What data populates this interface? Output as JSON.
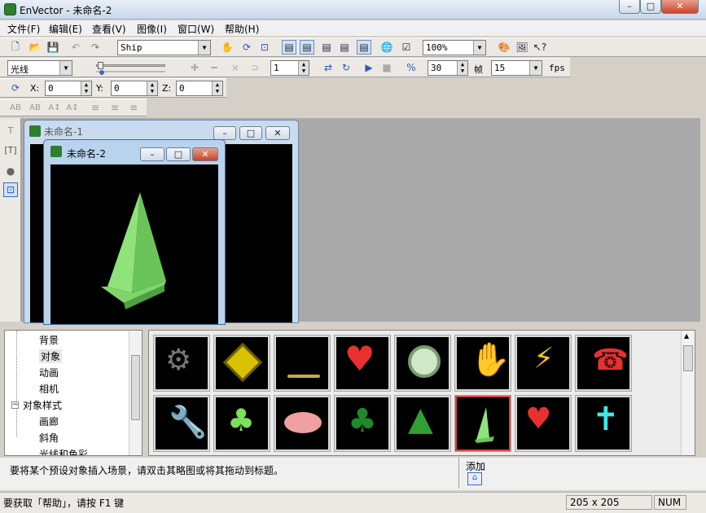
{
  "app": {
    "title": "EnVector - 未命名-2"
  },
  "titlebar": {
    "minimize": "–",
    "maximize": "□",
    "close": "✕"
  },
  "menubar": {
    "items": [
      "文件(F)",
      "编辑(E)",
      "查看(V)",
      "图像(I)",
      "窗口(W)",
      "帮助(H)"
    ]
  },
  "toolbar1": {
    "object_select": "Ship",
    "zoom_select": "100%"
  },
  "toolbar2": {
    "light_select": "光线",
    "frame_field": "1",
    "fps_value_field": "30",
    "frame_label": "帧",
    "fps_select": "15",
    "fps_label": "fps"
  },
  "toolbar3": {
    "x_label": "X:",
    "x_value": "0",
    "y_label": "Y:",
    "y_value": "0",
    "z_label": "Z:",
    "z_value": "0"
  },
  "documents": [
    {
      "title": "未命名-1"
    },
    {
      "title": "未命名-2"
    }
  ],
  "tree": {
    "items": [
      "背景",
      "对象",
      "动画",
      "相机",
      "对象样式",
      "画廊",
      "斜角",
      "光线和色彩"
    ]
  },
  "gallery": {
    "row1": [
      "gear-icon",
      "worker-sign-icon",
      "bird-icon",
      "heart-icon",
      "film-reel-icon",
      "flame-hand-icon",
      "lightning-icon",
      "phone-icon"
    ],
    "row2": [
      "wrench-icon",
      "clover-icon",
      "crab-icon",
      "four-leaf-clover-icon",
      "tree-icon",
      "ship-icon",
      "heart-arrow-icon",
      "cross-icon"
    ]
  },
  "hint": {
    "text": "要将某个预设对象插入场景，请双击其略图或将其拖动到标题。",
    "add_label": "添加"
  },
  "status": {
    "help_text": "要获取「帮助」，请按 F1 键",
    "size": "205 x 205",
    "num": "NUM"
  },
  "colors": {
    "accent_green": "#8fe37a",
    "workspace": "#aaaaaa",
    "selected_border": "#e04040"
  }
}
